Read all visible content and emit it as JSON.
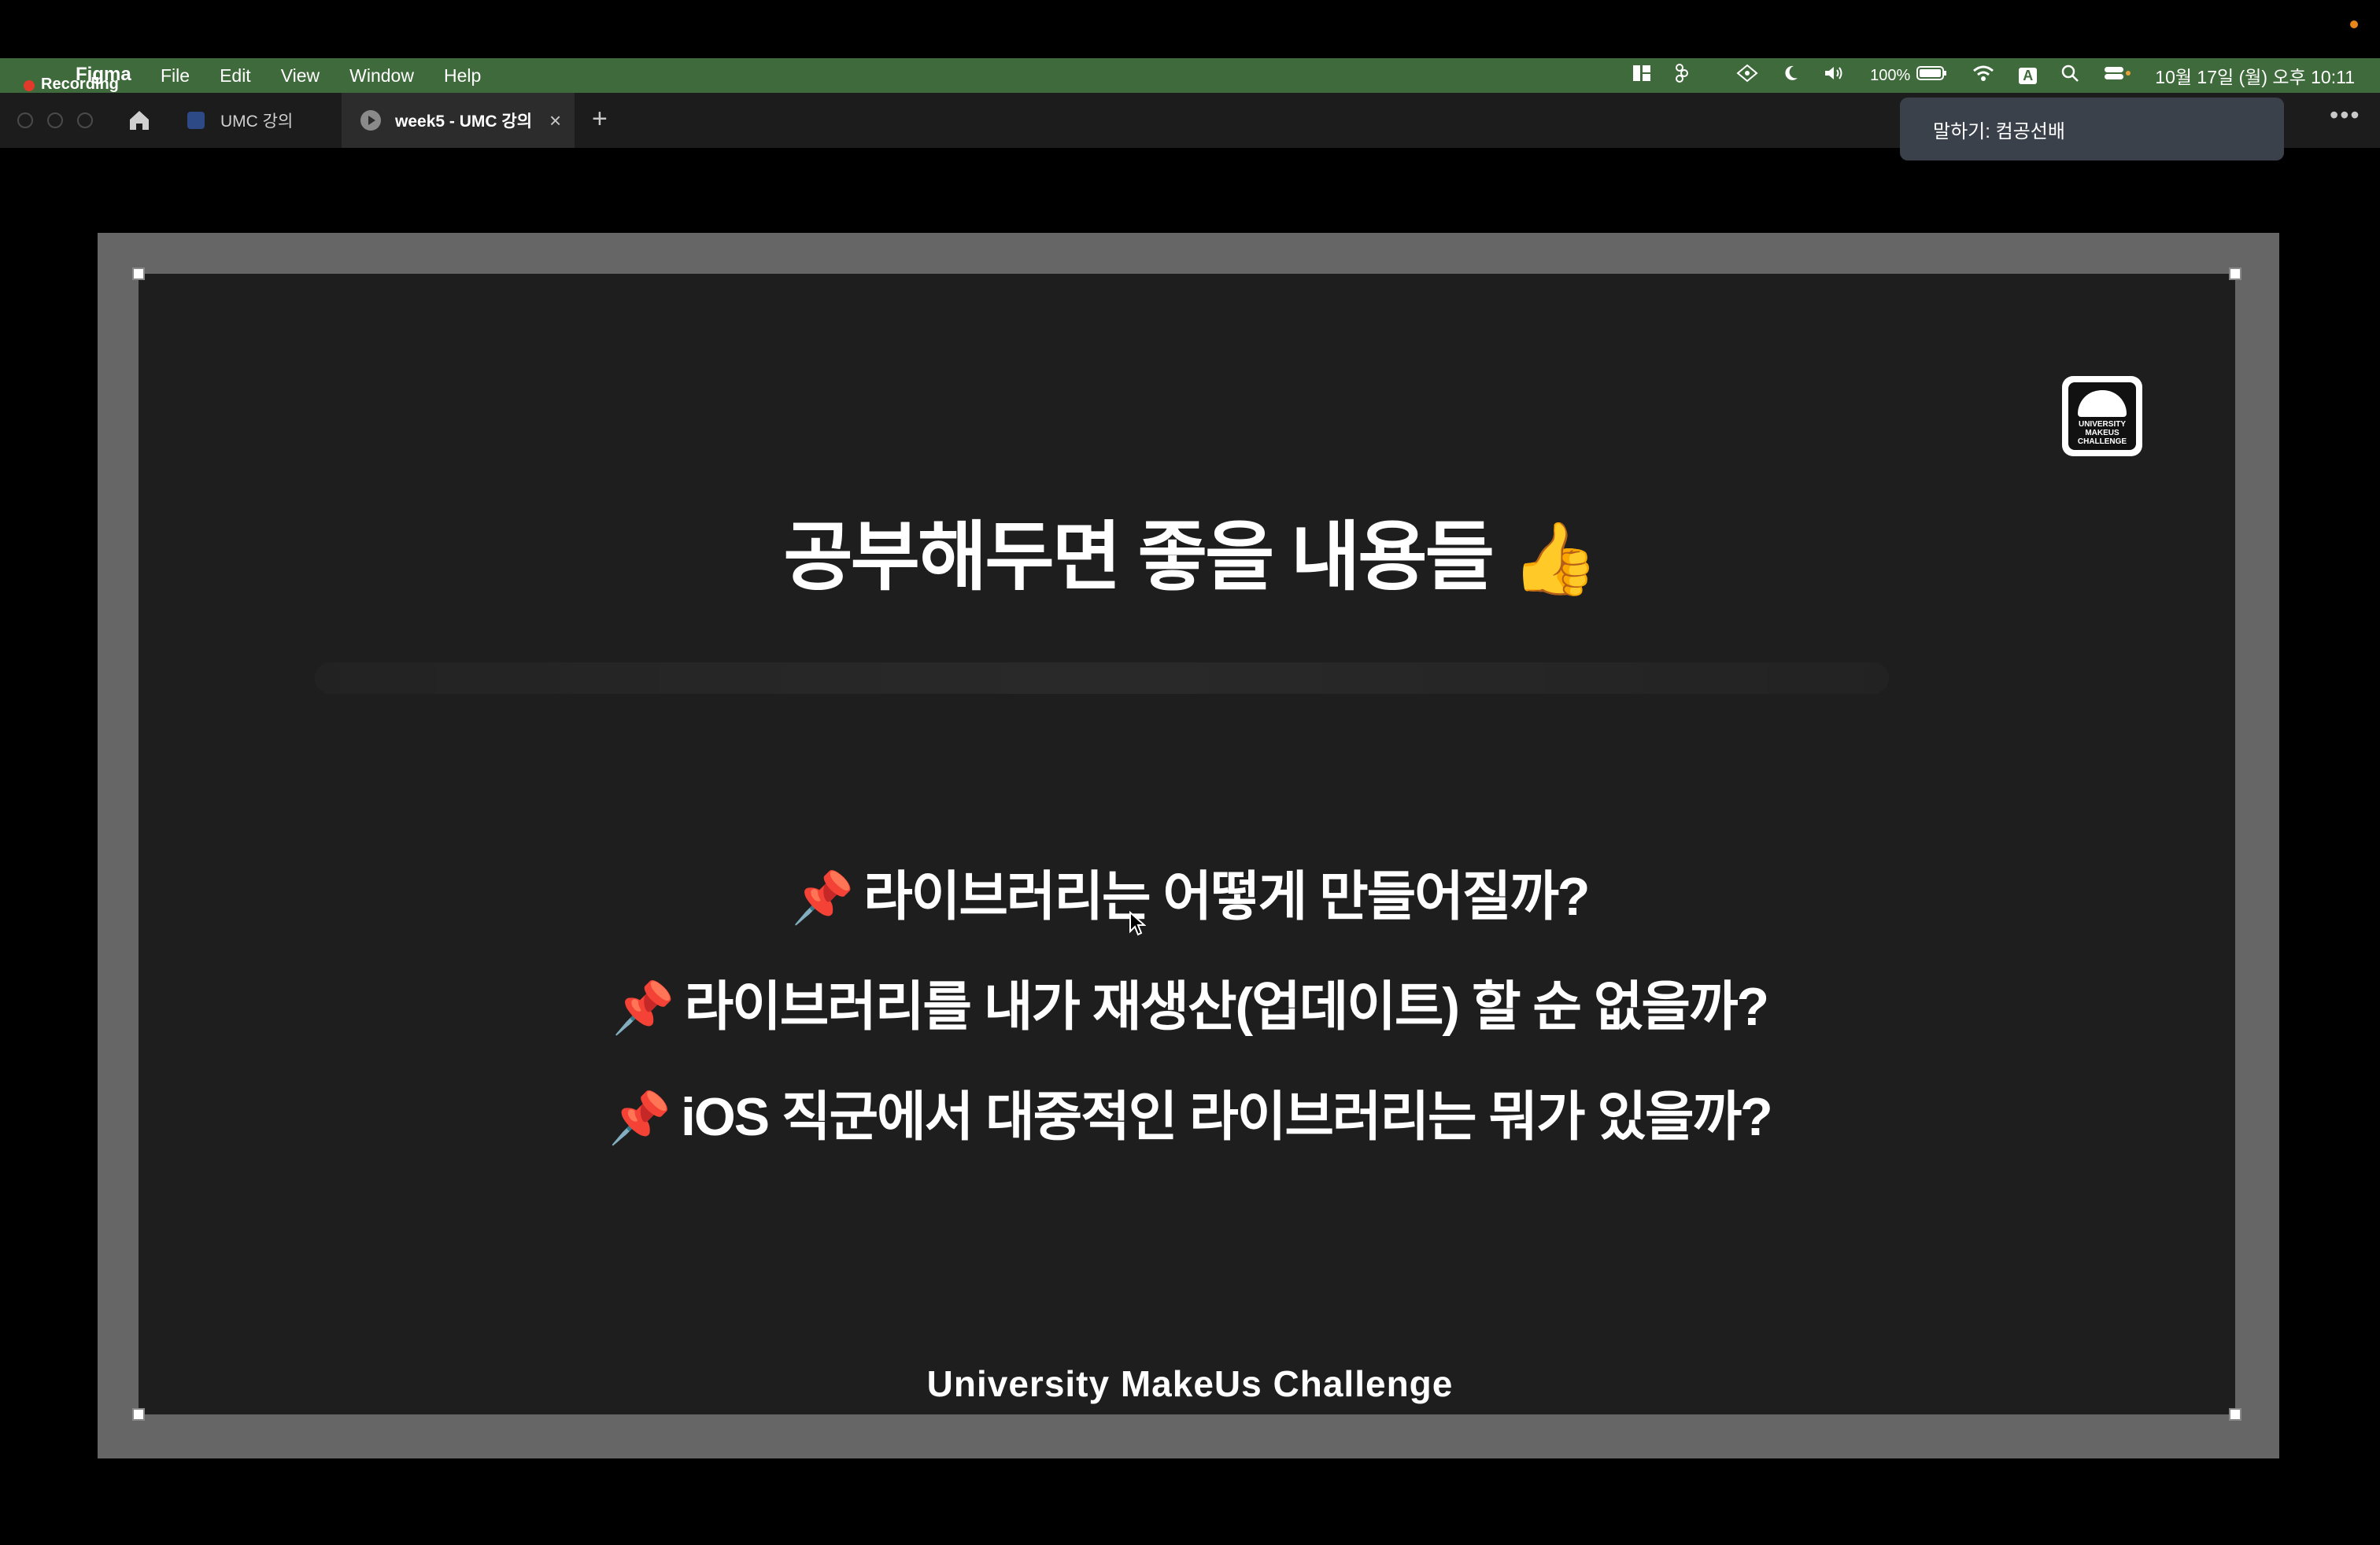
{
  "menubar": {
    "app_name": "Figma",
    "recording_label": "Recording",
    "items": [
      "File",
      "Edit",
      "View",
      "Window",
      "Help"
    ],
    "battery": "100%",
    "input_indicator": "A",
    "datetime": "10월 17일 (월) 오후 10:11"
  },
  "tabs": [
    {
      "label": "UMC 강의",
      "active": false
    },
    {
      "label": "week5 - UMC 강의",
      "active": true
    }
  ],
  "toast": {
    "text": "말하기: 컴공선배"
  },
  "slide": {
    "title": "공부해두면 좋을 내용들",
    "title_emoji": "👍",
    "bullet_icon": "📌",
    "bullets": [
      "라이브러리는 어떻게 만들어질까?",
      "라이브러리를 내가 재생산(업데이트) 할 순 없을까?",
      "iOS 직군에서 대중적인 라이브러리는 뭐가 있을까?"
    ],
    "logo_text": "UNIVERSITY MAKEUS CHALLENGE",
    "footer": "University MakeUs Challenge"
  },
  "colors": {
    "menubar": "#3f6a3b",
    "slide_bg": "#1e1e1e",
    "frame": "#666666",
    "toast": "#3a414b"
  }
}
